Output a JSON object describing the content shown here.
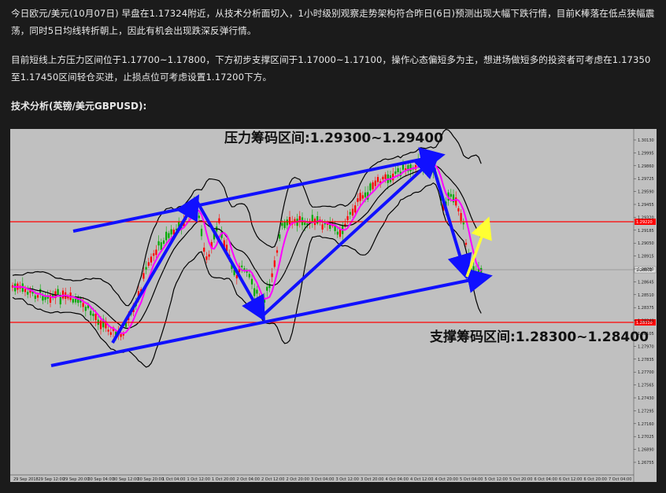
{
  "article": {
    "paragraph1": "今日欧元/美元(10月07日) 早盘在1.17324附近，从技术分析面切入，1小时级别观察走势架构符合昨日(6日)预测出现大幅下跌行情，目前K棒落在低点狭幅震荡，同时5日均线转折朝上，因此有机会出现跌深反弹行情。",
    "paragraph2": "目前短线上方压力区间位于1.17700~1.17800，下方初步支撑区间于1.17000~1.17100，操作心态偏短多为主，想进场做短多的投资者可考虑在1.17350至1.17450区间轻仓买进，止损点位可考虑设置1.17200下方。",
    "heading": "技术分析(英镑/美元GBPUSD):"
  },
  "chart": {
    "resistance_label": "压力筹码区间:1.29300~1.29400",
    "support_label": "支撑筹码区间:1.28300~1.28400",
    "resistance_line_price": "1.29220",
    "support_line_price": "1.28310",
    "current_price": "1.28802",
    "price_ticks": [
      "1.30130",
      "1.29995",
      "1.29860",
      "1.29725",
      "1.29590",
      "1.29455",
      "1.29320",
      "1.29185",
      "1.29050",
      "1.28915",
      "1.28780",
      "1.28645",
      "1.28510",
      "1.28375",
      "1.28240",
      "1.28105",
      "1.27970",
      "1.27835",
      "1.27700",
      "1.27565",
      "1.27430",
      "1.27295",
      "1.27160",
      "1.27025",
      "1.26890",
      "1.26755"
    ],
    "time_ticks": [
      "29 Sep 2018",
      "29 Sep 12:00",
      "29 Sep 20:00",
      "30 Sep 04:00",
      "30 Sep 12:00",
      "30 Sep 20:00",
      "1 Oct 04:00",
      "1 Oct 12:00",
      "1 Oct 20:00",
      "2 Oct 04:00",
      "2 Oct 12:00",
      "2 Oct 20:00",
      "3 Oct 04:00",
      "3 Oct 12:00",
      "3 Oct 20:00",
      "4 Oct 04:00",
      "4 Oct 12:00",
      "4 Oct 20:00",
      "5 Oct 04:00",
      "5 Oct 12:00",
      "5 Oct 20:00",
      "6 Oct 04:00",
      "6 Oct 12:00",
      "6 Oct 20:00",
      "7 Oct 04:00"
    ],
    "colors": {
      "background": "#c0c0c0",
      "bull_candle": "#ff0000",
      "bear_candle": "#00aa00",
      "bands": "#000000",
      "ma": "#ff00ff",
      "trend_arrow": "#1010ff",
      "level_line": "#ff0000",
      "projection_arrow": "#ffff00"
    }
  }
}
